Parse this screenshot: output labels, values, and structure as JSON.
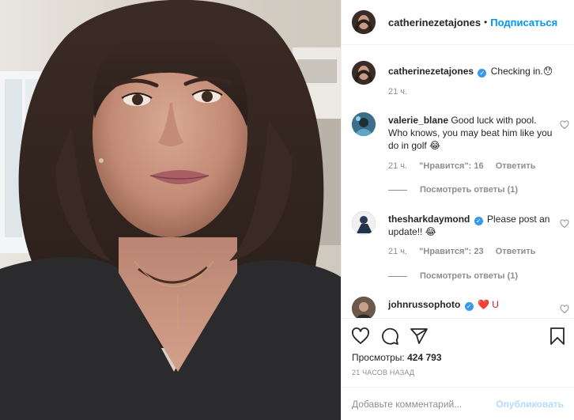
{
  "post": {
    "author": "catherinezetajones",
    "dot": "•",
    "follow_label": "Подписаться"
  },
  "caption": {
    "username": "catherinezetajones",
    "text": "Checking in.",
    "emoji": "😯",
    "time": "21 ч."
  },
  "comments": [
    {
      "username": "valerie_blane",
      "verified": false,
      "text": "Good luck with pool. Who knows, you may beat him like you do in golf 😂",
      "time": "21 ч.",
      "likes": "\"Нравится\": 16",
      "reply_label": "Ответить",
      "view_replies": "Посмотреть ответы (1)"
    },
    {
      "username": "thesharkdaymond",
      "verified": true,
      "text": "Please post an update!! 😂",
      "time": "21 ч.",
      "likes": "\"Нравится\": 23",
      "reply_label": "Ответить",
      "view_replies": "Посмотреть ответы (1)"
    },
    {
      "username": "johnrussophoto",
      "verified": true,
      "text": "❤️ U",
      "time": "",
      "likes": "",
      "reply_label": ""
    }
  ],
  "actions": {
    "views_label": "Просмотры:",
    "views_count": "424 793",
    "time_ago": "21 часов назад",
    "comment_placeholder": "Добавьте комментарий...",
    "post_label": "Опубликовать"
  },
  "icons": {
    "like": "heart-icon",
    "comment": "comment-icon",
    "share": "share-icon",
    "save": "bookmark-icon",
    "verified": "verified-badge-icon"
  },
  "colors": {
    "link_blue": "#0095f6",
    "verified_blue": "#3897f0",
    "meta_gray": "#8e8e8e",
    "text": "#262626"
  }
}
